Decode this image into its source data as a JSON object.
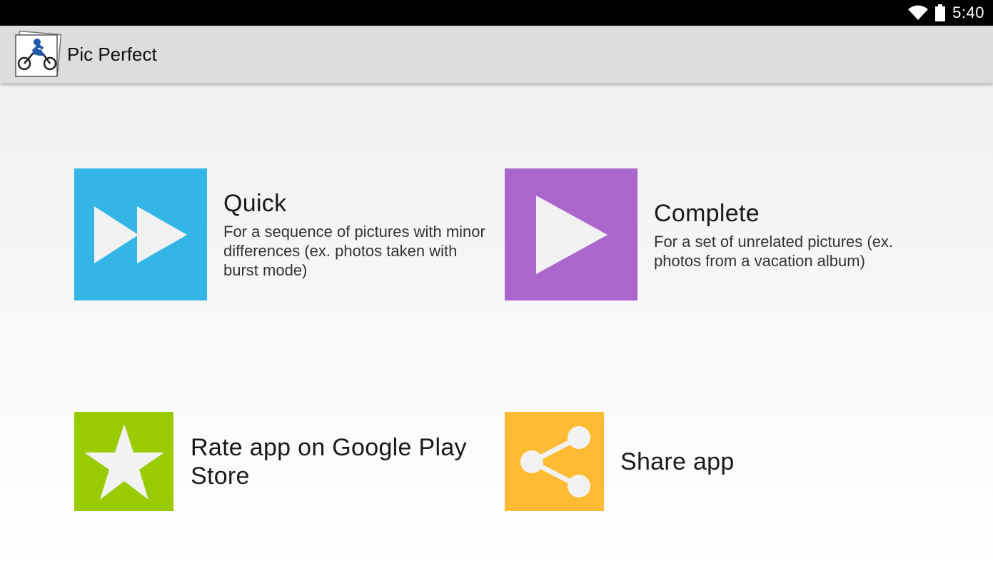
{
  "status_bar": {
    "time": "5:40",
    "icons": [
      "wifi-icon",
      "battery-icon"
    ]
  },
  "app_bar": {
    "title": "Pic Perfect",
    "logo_icon": "motorbike-photo-stack-icon"
  },
  "cards": {
    "quick": {
      "title": "Quick",
      "description": "For a sequence of pictures with minor differences (ex. photos taken with burst mode)",
      "icon": "fast-forward-icon",
      "color": "#33b5e5"
    },
    "complete": {
      "title": "Complete",
      "description": "For a set of unrelated pictures (ex. photos from a vacation album)",
      "icon": "play-icon",
      "color": "#aa66cc"
    },
    "rate": {
      "label": "Rate app on Google Play Store",
      "icon": "star-icon",
      "color": "#99cc00"
    },
    "share": {
      "label": "Share app",
      "icon": "share-icon",
      "color": "#ffbb33"
    }
  }
}
